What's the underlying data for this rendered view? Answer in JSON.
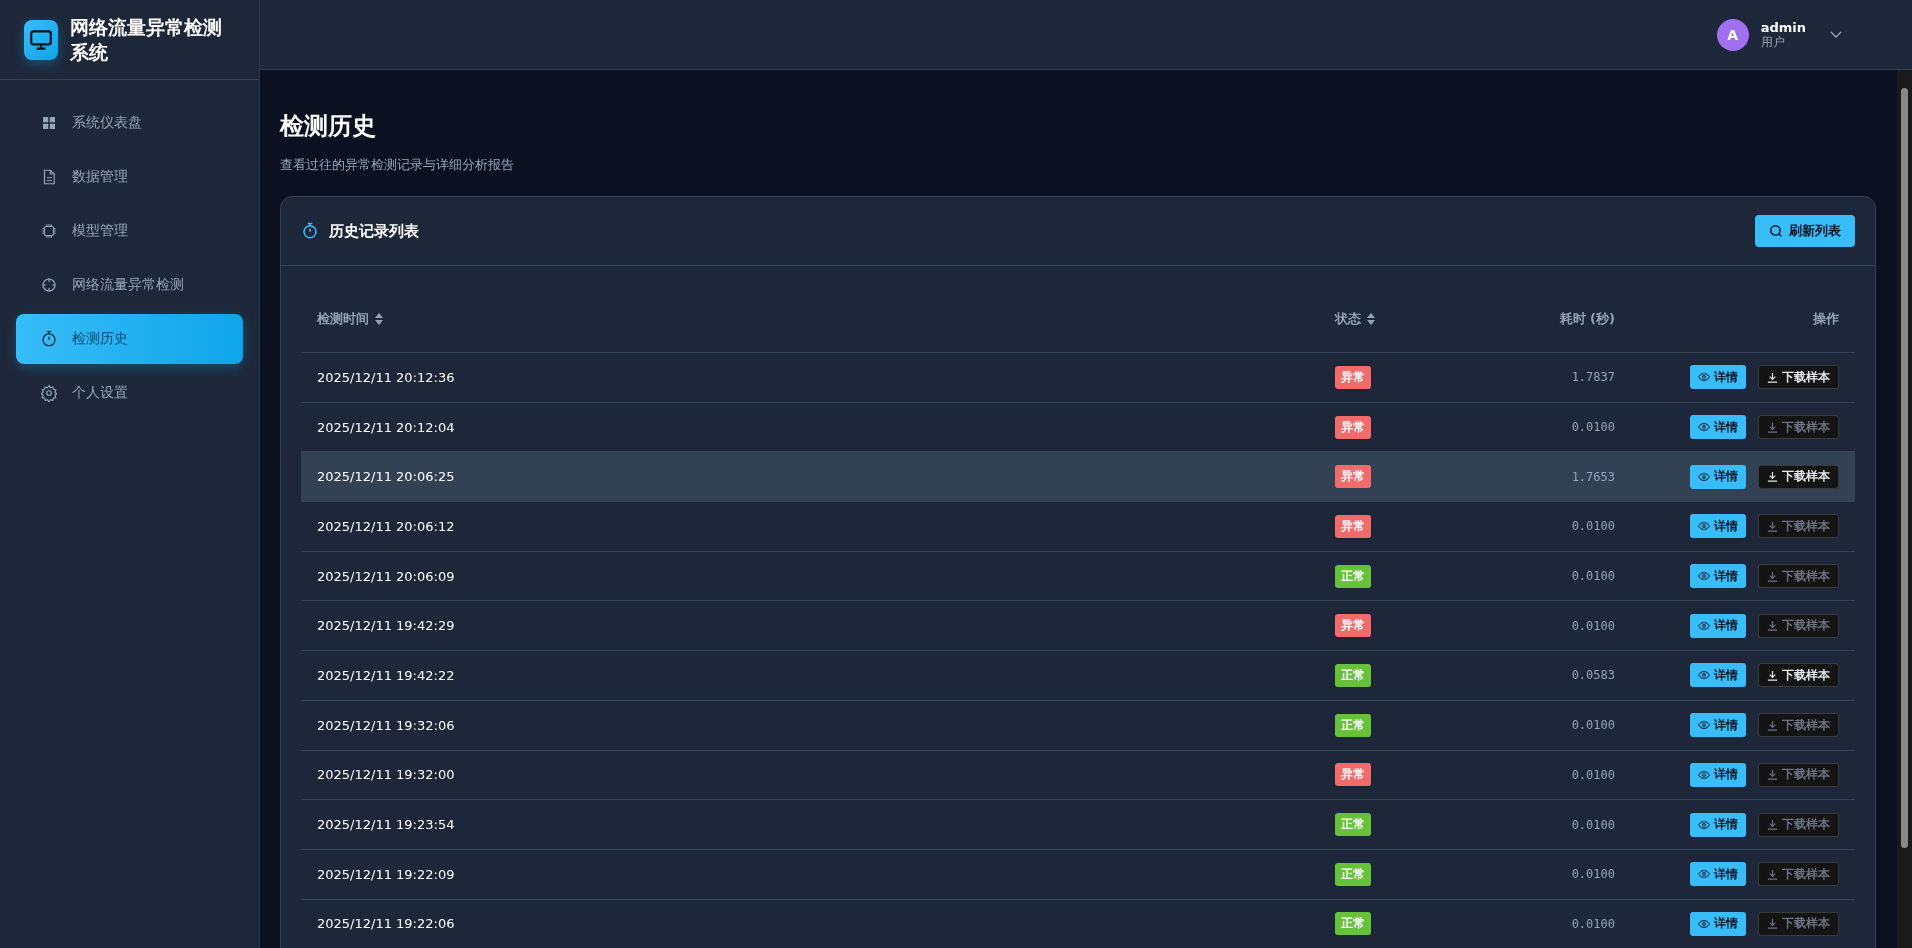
{
  "app": {
    "title": "网络流量异常检测系统"
  },
  "sidebar": {
    "items": [
      {
        "label": "系统仪表盘",
        "selected": false
      },
      {
        "label": "数据管理",
        "selected": false
      },
      {
        "label": "模型管理",
        "selected": false
      },
      {
        "label": "网络流量异常检测",
        "selected": false
      },
      {
        "label": "检测历史",
        "selected": true
      },
      {
        "label": "个人设置",
        "selected": false
      }
    ]
  },
  "user": {
    "avatar": "A",
    "name": "admin",
    "role": "用户"
  },
  "page": {
    "title": "检测历史",
    "subtitle": "查看过往的异常检测记录与详细分析报告"
  },
  "card": {
    "title": "历史记录列表",
    "refresh_button": "刷新列表"
  },
  "table": {
    "columns": [
      {
        "label": "检测时间",
        "sortable": true
      },
      {
        "label": "状态",
        "sortable": true
      },
      {
        "label": "耗时 (秒)",
        "sortable": false
      },
      {
        "label": "操作",
        "sortable": false
      }
    ],
    "rows": [
      {
        "time": "2025/12/11 20:12:36",
        "status": "异常",
        "kind": "anomaly",
        "duration": "1.7837",
        "detail": "详情",
        "download": "下载样本",
        "download_disabled": false,
        "selected": false
      },
      {
        "time": "2025/12/11 20:12:04",
        "status": "异常",
        "kind": "anomaly",
        "duration": "0.0100",
        "detail": "详情",
        "download": "下载样本",
        "download_disabled": true,
        "selected": false
      },
      {
        "time": "2025/12/11 20:06:25",
        "status": "异常",
        "kind": "anomaly",
        "duration": "1.7653",
        "detail": "详情",
        "download": "下载样本",
        "download_disabled": false,
        "selected": true
      },
      {
        "time": "2025/12/11 20:06:12",
        "status": "异常",
        "kind": "anomaly",
        "duration": "0.0100",
        "detail": "详情",
        "download": "下载样本",
        "download_disabled": true,
        "selected": false
      },
      {
        "time": "2025/12/11 20:06:09",
        "status": "正常",
        "kind": "normal",
        "duration": "0.0100",
        "detail": "详情",
        "download": "下载样本",
        "download_disabled": true,
        "selected": false
      },
      {
        "time": "2025/12/11 19:42:29",
        "status": "异常",
        "kind": "anomaly",
        "duration": "0.0100",
        "detail": "详情",
        "download": "下载样本",
        "download_disabled": true,
        "selected": false
      },
      {
        "time": "2025/12/11 19:42:22",
        "status": "正常",
        "kind": "normal",
        "duration": "0.0583",
        "detail": "详情",
        "download": "下载样本",
        "download_disabled": false,
        "selected": false
      },
      {
        "time": "2025/12/11 19:32:06",
        "status": "正常",
        "kind": "normal",
        "duration": "0.0100",
        "detail": "详情",
        "download": "下载样本",
        "download_disabled": true,
        "selected": false
      },
      {
        "time": "2025/12/11 19:32:00",
        "status": "异常",
        "kind": "anomaly",
        "duration": "0.0100",
        "detail": "详情",
        "download": "下载样本",
        "download_disabled": true,
        "selected": false
      },
      {
        "time": "2025/12/11 19:23:54",
        "status": "正常",
        "kind": "normal",
        "duration": "0.0100",
        "detail": "详情",
        "download": "下载样本",
        "download_disabled": true,
        "selected": false
      },
      {
        "time": "2025/12/11 19:22:09",
        "status": "正常",
        "kind": "normal",
        "duration": "0.0100",
        "detail": "详情",
        "download": "下载样本",
        "download_disabled": true,
        "selected": false
      },
      {
        "time": "2025/12/11 19:22:06",
        "status": "正常",
        "kind": "normal",
        "duration": "0.0100",
        "detail": "详情",
        "download": "下载样本",
        "download_disabled": true,
        "selected": false
      }
    ]
  }
}
